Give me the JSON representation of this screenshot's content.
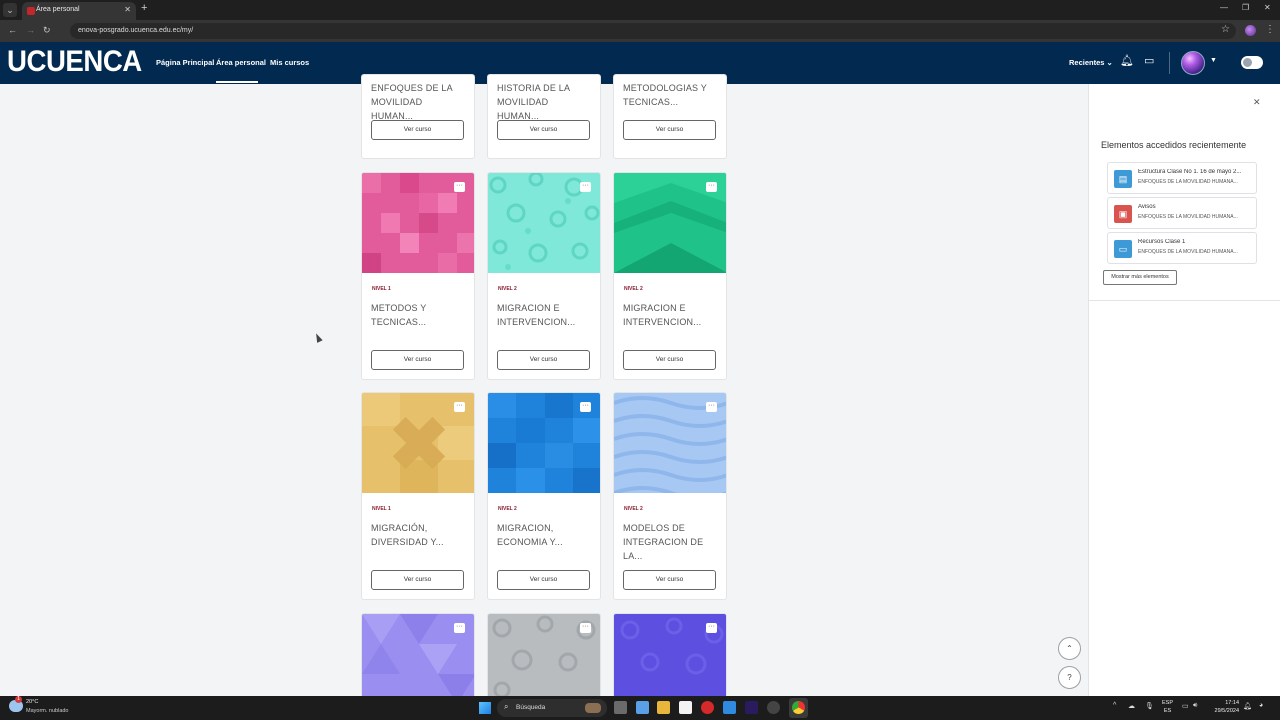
{
  "browser": {
    "tab_title": "Área personal",
    "url": "enova-posgrado.ucuenca.edu.ec/my/"
  },
  "site": {
    "logo": "UCUENCA",
    "nav": [
      "Página Principal",
      "Área personal",
      "Mis cursos"
    ],
    "recientes": "Recientes"
  },
  "courses": [
    {
      "nivel": "",
      "title": "ENFOQUES DE LA MOVILIDAD HUMAN...",
      "button": "Ver curso"
    },
    {
      "nivel": "",
      "title": "HISTORIA DE LA MOVILIDAD HUMAN...",
      "button": "Ver curso"
    },
    {
      "nivel": "",
      "title": "METODOLOGIAS Y TECNICAS...",
      "button": "Ver curso"
    },
    {
      "nivel": "NIVEL 1",
      "title": "METODOS Y TECNICAS...",
      "button": "Ver curso",
      "color": "#e25b9a"
    },
    {
      "nivel": "NIVEL 2",
      "title": "MIGRACION E INTERVENCION...",
      "button": "Ver curso",
      "color": "#7fe8d8"
    },
    {
      "nivel": "NIVEL 2",
      "title": "MIGRACION E INTERVENCION...",
      "button": "Ver curso",
      "color": "#1fc38a"
    },
    {
      "nivel": "NIVEL 1",
      "title": "MIGRACIÓN, DIVERSIDAD Y...",
      "button": "Ver curso",
      "color": "#e6c06a"
    },
    {
      "nivel": "NIVEL 2",
      "title": "MIGRACION, ECONOMIA Y...",
      "button": "Ver curso",
      "color": "#1f82db"
    },
    {
      "nivel": "NIVEL 2",
      "title": "MODELOS DE INTEGRACION DE LA...",
      "button": "Ver curso",
      "color": "#a6c8f2"
    },
    {
      "nivel": "",
      "title": "",
      "button": "",
      "color": "#9a8ef0"
    },
    {
      "nivel": "",
      "title": "",
      "button": "",
      "color": "#b8bcbf"
    },
    {
      "nivel": "",
      "title": "",
      "button": "",
      "color": "#5d4fe0"
    }
  ],
  "drawer": {
    "title": "Elementos accedidos recientemente",
    "items": [
      {
        "name": "Estructura Clase No 1. 16 de mayo 2...",
        "course": "ENFOQUES DE LA MOVILIDAD HUMANA...",
        "icon": "document-icon",
        "color": "#3e9ad6"
      },
      {
        "name": "Avisos",
        "course": "ENFOQUES DE LA MOVILIDAD HUMANA...",
        "icon": "forum-icon",
        "color": "#d9534f"
      },
      {
        "name": "Recursos Clase 1",
        "course": "ENFOQUES DE LA MOVILIDAD HUMANA...",
        "icon": "folder-icon",
        "color": "#3e9ad6"
      }
    ],
    "more": "Mostrar más elementos"
  },
  "taskbar": {
    "temp": "20°C",
    "weather": "Mayorm. nublado",
    "search": "Búsqueda",
    "lang_top": "ESP",
    "lang_bottom": "ES",
    "time": "17:14",
    "date": "29/5/2024"
  }
}
